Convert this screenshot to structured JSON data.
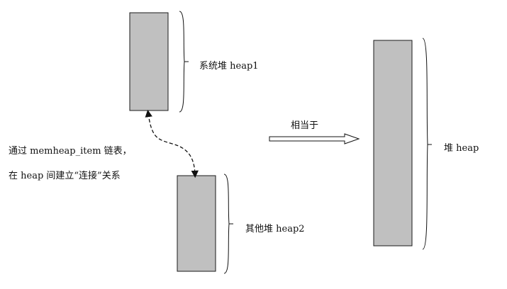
{
  "colors": {
    "block_fill": "#c0c0c0",
    "block_stroke": "#1a1a1a",
    "line": "#111111",
    "background": "#ffffff"
  },
  "heap1": {
    "label": "系统堆 heap1"
  },
  "heap2": {
    "label": "其他堆 heap2"
  },
  "heap_total": {
    "label": "堆 heap"
  },
  "equivalence": {
    "label": "相当于"
  },
  "note": {
    "line1": "通过 memheap_item 链表，",
    "line2": "在 heap 间建立“连接”关系"
  }
}
